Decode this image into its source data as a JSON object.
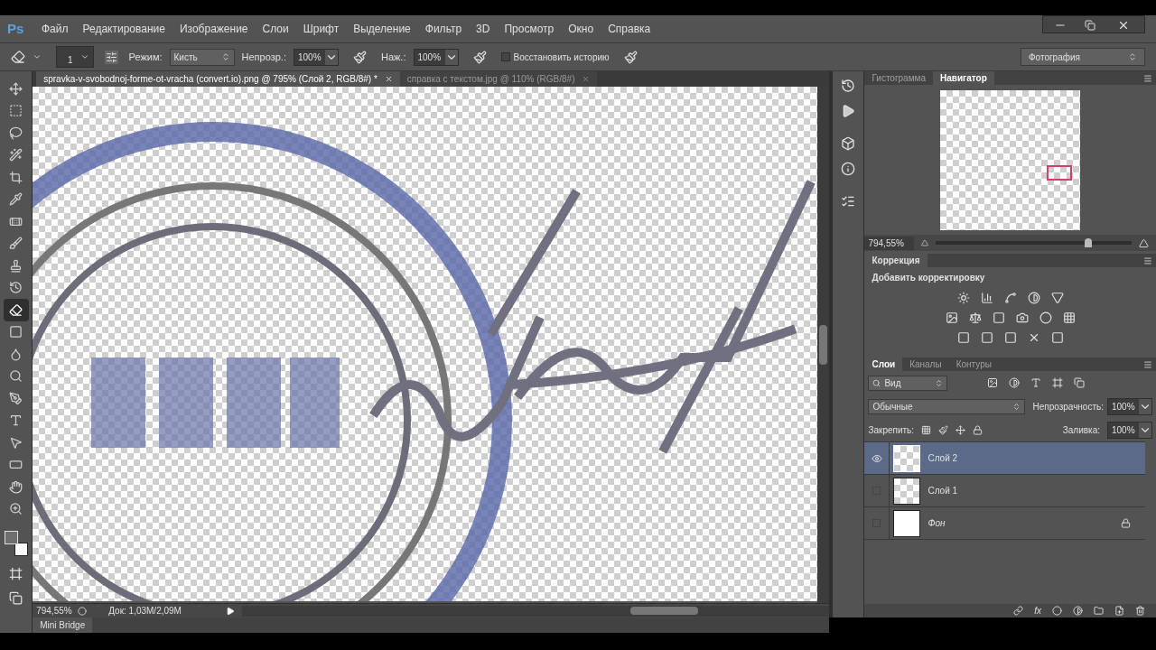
{
  "app": {
    "logo": "Ps"
  },
  "menu": [
    "Файл",
    "Редактирование",
    "Изображение",
    "Слои",
    "Шрифт",
    "Выделение",
    "Фильтр",
    "3D",
    "Просмотр",
    "Окно",
    "Справка"
  ],
  "options_bar": {
    "brush_size": "1",
    "mode_label": "Режим:",
    "mode": "Кисть",
    "opacity_label": "Непрозр.:",
    "opacity": "100%",
    "flow_label": "Наж.:",
    "flow": "100%",
    "restore_history": {
      "label": "Восстановить историю",
      "checked": false
    },
    "workspace": "Фотография"
  },
  "documents": [
    {
      "title": "spravka-v-svobodnoj-forme-ot-vracha (convert.io).png @ 795% (Слой 2, RGB/8#) *",
      "selected": true
    },
    {
      "title": "справка с текстом.jpg @ 110% (RGB/8#)",
      "selected": false
    }
  ],
  "tools": [
    {
      "selected": false
    },
    {
      "selected": false
    },
    {
      "selected": false
    },
    {
      "selected": false
    },
    {
      "selected": false
    },
    {
      "selected": false
    },
    {
      "selected": false
    },
    {
      "selected": false
    },
    {
      "selected": false
    },
    {
      "selected": false
    },
    {
      "selected": true
    },
    {
      "selected": false
    },
    {
      "selected": false
    },
    {
      "selected": false
    },
    {
      "selected": false
    },
    {
      "selected": false
    },
    {
      "selected": false
    },
    {
      "selected": false
    },
    {
      "selected": false
    },
    {
      "selected": false
    }
  ],
  "status_bar": {
    "zoom": "794,55%",
    "doc": "Док: 1,03M/2,09M"
  },
  "mini_bridge": "Mini Bridge",
  "navigator": {
    "tabs": [
      {
        "label": "Гистограмма",
        "selected": false
      },
      {
        "label": "Навигатор",
        "selected": true
      }
    ],
    "zoom": "794,55%",
    "level": 0.78
  },
  "adjustments": {
    "tab": "Коррекция",
    "heading": "Добавить корректировку"
  },
  "layers_panel": {
    "tabs": [
      {
        "label": "Слои",
        "selected": true
      },
      {
        "label": "Каналы",
        "selected": false
      },
      {
        "label": "Контуры",
        "selected": false
      }
    ],
    "filter": "Вид",
    "blend_mode": "Обычные",
    "opacity_label": "Непрозрачность:",
    "opacity": "100%",
    "lock_label": "Закрепить:",
    "fill_label": "Заливка:",
    "fill": "100%",
    "fx_label": "fx",
    "layers": [
      {
        "name": "Слой 2",
        "kind": "layer",
        "visible": true,
        "selected": true,
        "locked": false
      },
      {
        "name": "Слой 1",
        "kind": "layer",
        "visible": false,
        "selected": false,
        "locked": false
      },
      {
        "name": "Фон",
        "kind": "background",
        "visible": false,
        "selected": false,
        "locked": true
      }
    ]
  }
}
